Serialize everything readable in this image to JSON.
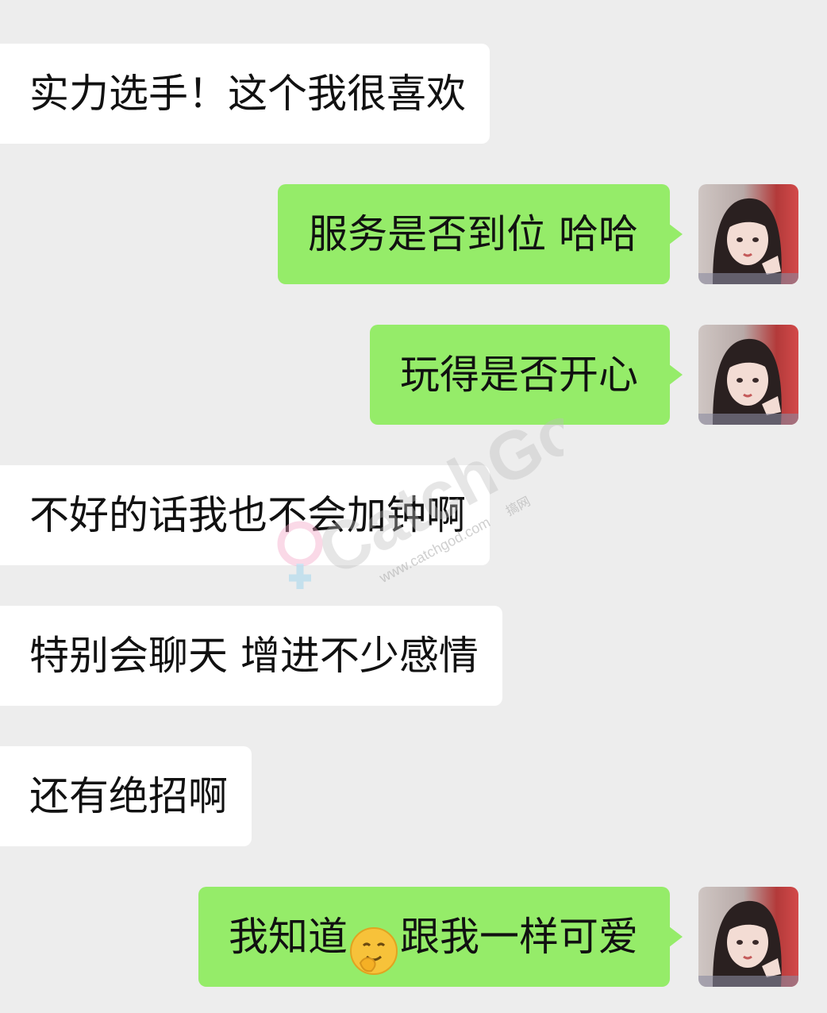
{
  "messages": [
    {
      "side": "in",
      "text": "实力选手！这个我很喜欢"
    },
    {
      "side": "out",
      "text": "服务是否到位 哈哈"
    },
    {
      "side": "out",
      "text": "玩得是否开心"
    },
    {
      "side": "in",
      "text": "不好的话我也不会加钟啊"
    },
    {
      "side": "in",
      "text": "特别会聊天 增进不少感情"
    },
    {
      "side": "in",
      "text": "还有绝招啊"
    },
    {
      "side": "out",
      "text_before": "我知道",
      "emoji": "hugging-face-emoji",
      "text_after": "跟我一样可爱"
    }
  ],
  "avatar": {
    "icon": "user-avatar-photo"
  },
  "colors": {
    "background": "#ededed",
    "incoming_bubble": "#ffffff",
    "outgoing_bubble": "#95ec69"
  },
  "watermark": {
    "brand": "CatchGod",
    "url": "www.catchgod.com",
    "suffix": "搞网"
  }
}
